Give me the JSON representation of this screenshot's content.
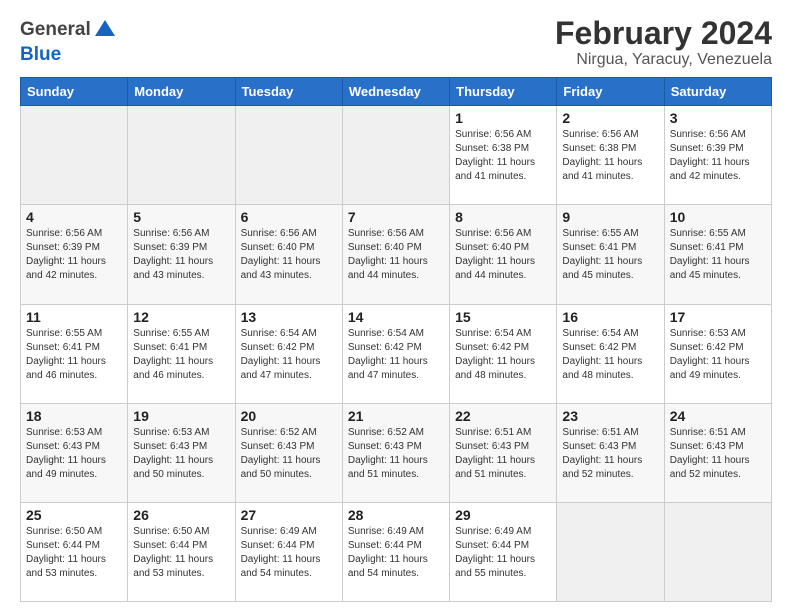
{
  "header": {
    "title": "February 2024",
    "subtitle": "Nirgua, Yaracuy, Venezuela",
    "logo_general": "General",
    "logo_blue": "Blue"
  },
  "weekdays": [
    "Sunday",
    "Monday",
    "Tuesday",
    "Wednesday",
    "Thursday",
    "Friday",
    "Saturday"
  ],
  "weeks": [
    [
      {
        "day": "",
        "sunrise": "",
        "sunset": "",
        "daylight": "",
        "empty": true
      },
      {
        "day": "",
        "sunrise": "",
        "sunset": "",
        "daylight": "",
        "empty": true
      },
      {
        "day": "",
        "sunrise": "",
        "sunset": "",
        "daylight": "",
        "empty": true
      },
      {
        "day": "",
        "sunrise": "",
        "sunset": "",
        "daylight": "",
        "empty": true
      },
      {
        "day": "1",
        "sunrise": "Sunrise: 6:56 AM",
        "sunset": "Sunset: 6:38 PM",
        "daylight": "Daylight: 11 hours and 41 minutes.",
        "empty": false
      },
      {
        "day": "2",
        "sunrise": "Sunrise: 6:56 AM",
        "sunset": "Sunset: 6:38 PM",
        "daylight": "Daylight: 11 hours and 41 minutes.",
        "empty": false
      },
      {
        "day": "3",
        "sunrise": "Sunrise: 6:56 AM",
        "sunset": "Sunset: 6:39 PM",
        "daylight": "Daylight: 11 hours and 42 minutes.",
        "empty": false
      }
    ],
    [
      {
        "day": "4",
        "sunrise": "Sunrise: 6:56 AM",
        "sunset": "Sunset: 6:39 PM",
        "daylight": "Daylight: 11 hours and 42 minutes.",
        "empty": false
      },
      {
        "day": "5",
        "sunrise": "Sunrise: 6:56 AM",
        "sunset": "Sunset: 6:39 PM",
        "daylight": "Daylight: 11 hours and 43 minutes.",
        "empty": false
      },
      {
        "day": "6",
        "sunrise": "Sunrise: 6:56 AM",
        "sunset": "Sunset: 6:40 PM",
        "daylight": "Daylight: 11 hours and 43 minutes.",
        "empty": false
      },
      {
        "day": "7",
        "sunrise": "Sunrise: 6:56 AM",
        "sunset": "Sunset: 6:40 PM",
        "daylight": "Daylight: 11 hours and 44 minutes.",
        "empty": false
      },
      {
        "day": "8",
        "sunrise": "Sunrise: 6:56 AM",
        "sunset": "Sunset: 6:40 PM",
        "daylight": "Daylight: 11 hours and 44 minutes.",
        "empty": false
      },
      {
        "day": "9",
        "sunrise": "Sunrise: 6:55 AM",
        "sunset": "Sunset: 6:41 PM",
        "daylight": "Daylight: 11 hours and 45 minutes.",
        "empty": false
      },
      {
        "day": "10",
        "sunrise": "Sunrise: 6:55 AM",
        "sunset": "Sunset: 6:41 PM",
        "daylight": "Daylight: 11 hours and 45 minutes.",
        "empty": false
      }
    ],
    [
      {
        "day": "11",
        "sunrise": "Sunrise: 6:55 AM",
        "sunset": "Sunset: 6:41 PM",
        "daylight": "Daylight: 11 hours and 46 minutes.",
        "empty": false
      },
      {
        "day": "12",
        "sunrise": "Sunrise: 6:55 AM",
        "sunset": "Sunset: 6:41 PM",
        "daylight": "Daylight: 11 hours and 46 minutes.",
        "empty": false
      },
      {
        "day": "13",
        "sunrise": "Sunrise: 6:54 AM",
        "sunset": "Sunset: 6:42 PM",
        "daylight": "Daylight: 11 hours and 47 minutes.",
        "empty": false
      },
      {
        "day": "14",
        "sunrise": "Sunrise: 6:54 AM",
        "sunset": "Sunset: 6:42 PM",
        "daylight": "Daylight: 11 hours and 47 minutes.",
        "empty": false
      },
      {
        "day": "15",
        "sunrise": "Sunrise: 6:54 AM",
        "sunset": "Sunset: 6:42 PM",
        "daylight": "Daylight: 11 hours and 48 minutes.",
        "empty": false
      },
      {
        "day": "16",
        "sunrise": "Sunrise: 6:54 AM",
        "sunset": "Sunset: 6:42 PM",
        "daylight": "Daylight: 11 hours and 48 minutes.",
        "empty": false
      },
      {
        "day": "17",
        "sunrise": "Sunrise: 6:53 AM",
        "sunset": "Sunset: 6:42 PM",
        "daylight": "Daylight: 11 hours and 49 minutes.",
        "empty": false
      }
    ],
    [
      {
        "day": "18",
        "sunrise": "Sunrise: 6:53 AM",
        "sunset": "Sunset: 6:43 PM",
        "daylight": "Daylight: 11 hours and 49 minutes.",
        "empty": false
      },
      {
        "day": "19",
        "sunrise": "Sunrise: 6:53 AM",
        "sunset": "Sunset: 6:43 PM",
        "daylight": "Daylight: 11 hours and 50 minutes.",
        "empty": false
      },
      {
        "day": "20",
        "sunrise": "Sunrise: 6:52 AM",
        "sunset": "Sunset: 6:43 PM",
        "daylight": "Daylight: 11 hours and 50 minutes.",
        "empty": false
      },
      {
        "day": "21",
        "sunrise": "Sunrise: 6:52 AM",
        "sunset": "Sunset: 6:43 PM",
        "daylight": "Daylight: 11 hours and 51 minutes.",
        "empty": false
      },
      {
        "day": "22",
        "sunrise": "Sunrise: 6:51 AM",
        "sunset": "Sunset: 6:43 PM",
        "daylight": "Daylight: 11 hours and 51 minutes.",
        "empty": false
      },
      {
        "day": "23",
        "sunrise": "Sunrise: 6:51 AM",
        "sunset": "Sunset: 6:43 PM",
        "daylight": "Daylight: 11 hours and 52 minutes.",
        "empty": false
      },
      {
        "day": "24",
        "sunrise": "Sunrise: 6:51 AM",
        "sunset": "Sunset: 6:43 PM",
        "daylight": "Daylight: 11 hours and 52 minutes.",
        "empty": false
      }
    ],
    [
      {
        "day": "25",
        "sunrise": "Sunrise: 6:50 AM",
        "sunset": "Sunset: 6:44 PM",
        "daylight": "Daylight: 11 hours and 53 minutes.",
        "empty": false
      },
      {
        "day": "26",
        "sunrise": "Sunrise: 6:50 AM",
        "sunset": "Sunset: 6:44 PM",
        "daylight": "Daylight: 11 hours and 53 minutes.",
        "empty": false
      },
      {
        "day": "27",
        "sunrise": "Sunrise: 6:49 AM",
        "sunset": "Sunset: 6:44 PM",
        "daylight": "Daylight: 11 hours and 54 minutes.",
        "empty": false
      },
      {
        "day": "28",
        "sunrise": "Sunrise: 6:49 AM",
        "sunset": "Sunset: 6:44 PM",
        "daylight": "Daylight: 11 hours and 54 minutes.",
        "empty": false
      },
      {
        "day": "29",
        "sunrise": "Sunrise: 6:49 AM",
        "sunset": "Sunset: 6:44 PM",
        "daylight": "Daylight: 11 hours and 55 minutes.",
        "empty": false
      },
      {
        "day": "",
        "sunrise": "",
        "sunset": "",
        "daylight": "",
        "empty": true
      },
      {
        "day": "",
        "sunrise": "",
        "sunset": "",
        "daylight": "",
        "empty": true
      }
    ]
  ]
}
